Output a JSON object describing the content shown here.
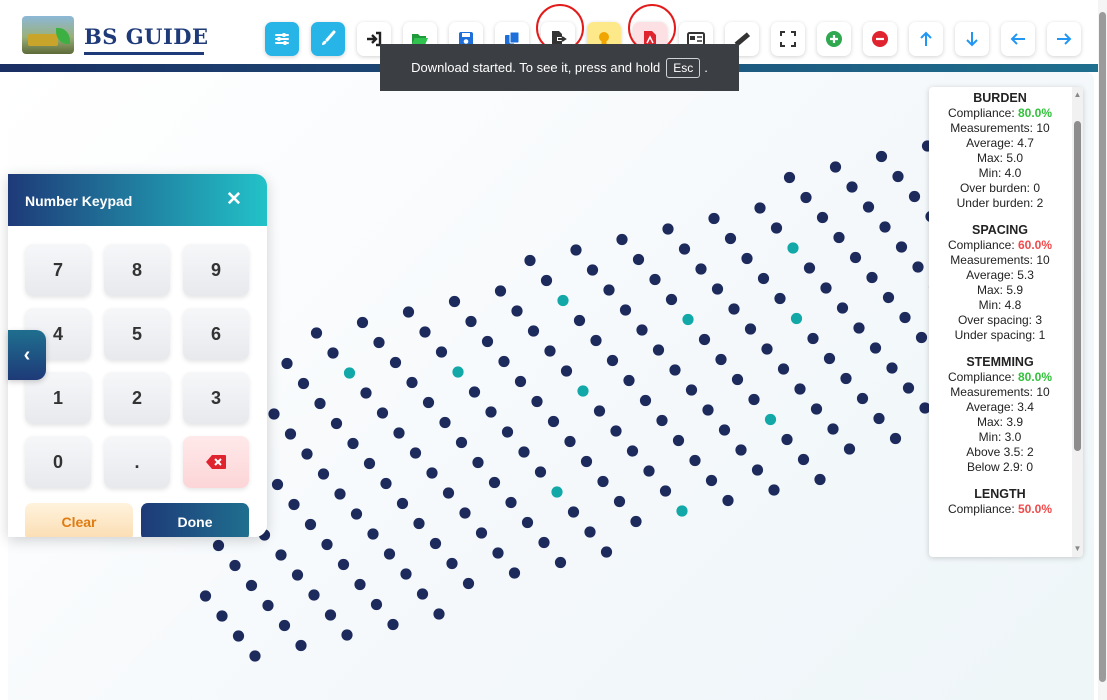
{
  "app": {
    "brand": "BS GUIDE",
    "logo_icon": "mining-truck-logo-icon"
  },
  "toolbar": {
    "buttons": [
      {
        "name": "settings-sliders-button",
        "icon": "sliders-icon",
        "accent": "#26b5e6"
      },
      {
        "name": "brush-button",
        "icon": "brush-icon",
        "accent": "#26b5e6"
      },
      {
        "name": "import-button",
        "icon": "sign-in-icon",
        "accent": "#ffffff"
      },
      {
        "name": "open-folder-button",
        "icon": "folder-open-icon",
        "accent": "#7be07c"
      },
      {
        "name": "save-button",
        "icon": "floppy-icon",
        "accent": "#bfe4fb"
      },
      {
        "name": "copy-button",
        "icon": "copy-icon",
        "accent": "#bfe4fb"
      },
      {
        "name": "export-button",
        "icon": "file-export-icon",
        "accent": "#ffffff",
        "highlighted": true
      },
      {
        "name": "idea-button",
        "icon": "lightbulb-icon",
        "accent": "#fde98a"
      },
      {
        "name": "pdf-button",
        "icon": "file-pdf-icon",
        "accent": "#fde0e3",
        "highlighted": true
      },
      {
        "name": "report-card-button",
        "icon": "id-card-icon",
        "accent": "#ffffff"
      },
      {
        "name": "measure-button",
        "icon": "ruler-icon",
        "accent": "#ffffff"
      },
      {
        "name": "fullscreen-button",
        "icon": "expand-icon",
        "accent": "#ffffff"
      },
      {
        "name": "add-button",
        "icon": "plus-circle-icon",
        "accent": "#2fa84f"
      },
      {
        "name": "remove-button",
        "icon": "minus-circle-icon",
        "accent": "#e0242f"
      },
      {
        "name": "move-up-button",
        "icon": "arrow-up-icon",
        "accent": "#2196f3"
      },
      {
        "name": "move-down-button",
        "icon": "arrow-down-icon",
        "accent": "#2196f3"
      },
      {
        "name": "move-left-button",
        "icon": "arrow-left-icon",
        "accent": "#2196f3"
      },
      {
        "name": "move-right-button",
        "icon": "arrow-right-icon",
        "accent": "#2196f3"
      }
    ]
  },
  "toast": {
    "message": "Download started. To see it, press and hold",
    "key": "Esc",
    "suffix": "."
  },
  "keypad": {
    "title": "Number Keypad",
    "close_icon": "close-icon",
    "keys": [
      "7",
      "8",
      "9",
      "4",
      "5",
      "6",
      "1",
      "2",
      "3",
      "0",
      "."
    ],
    "backspace_icon": "backspace-icon",
    "clear_label": "Clear",
    "done_label": "Done",
    "collapse_icon": "chevron-left-icon"
  },
  "stats": {
    "burden": {
      "title": "BURDEN",
      "compliance_label": "Compliance:",
      "compliance": "80.0%",
      "measurements": "Measurements: 10",
      "average": "Average: 4.7",
      "max": "Max: 5.0",
      "min": "Min: 4.0",
      "over": "Over burden: 0",
      "under": "Under burden: 2"
    },
    "spacing": {
      "title": "SPACING",
      "compliance_label": "Compliance:",
      "compliance": "60.0%",
      "measurements": "Measurements: 10",
      "average": "Average: 5.3",
      "max": "Max: 5.9",
      "min": "Min: 4.8",
      "over": "Over spacing: 3",
      "under": "Under spacing: 1"
    },
    "stemming": {
      "title": "STEMMING",
      "compliance_label": "Compliance:",
      "compliance": "80.0%",
      "measurements": "Measurements: 10",
      "average": "Average: 3.4",
      "max": "Max: 3.9",
      "min": "Min: 3.0",
      "above": "Above 3.5: 2",
      "below": "Below 2.9: 0"
    },
    "length": {
      "title": "LENGTH",
      "compliance_label": "Compliance:",
      "compliance": "50.0%"
    }
  },
  "colors": {
    "hole": "#1d2a5c",
    "hole_highlight": "#12a8a8",
    "good": "#32c13a",
    "bad": "#f04a4a",
    "brand": "#1e3a78"
  }
}
